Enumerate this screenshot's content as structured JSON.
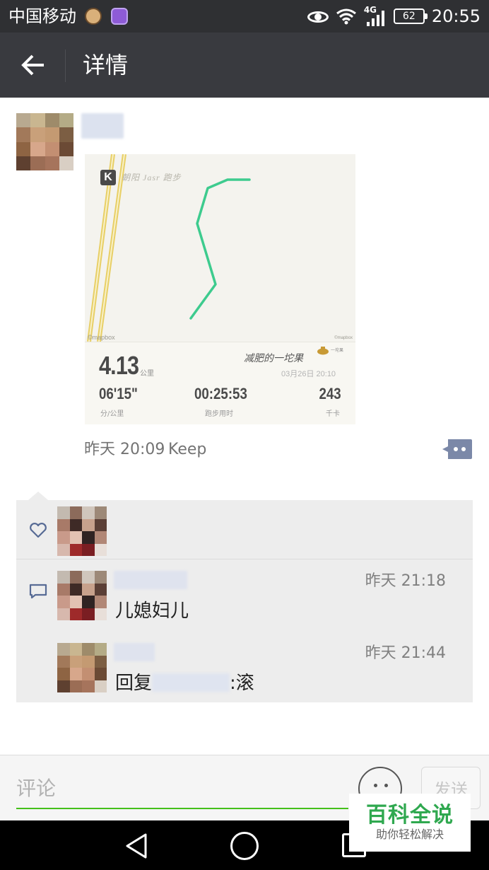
{
  "status_bar": {
    "carrier": "中国移动",
    "network": "4G",
    "battery": "62",
    "time": "20:55",
    "icons": [
      "eye-icon",
      "wifi-icon",
      "signal-icon",
      "battery-icon"
    ]
  },
  "header": {
    "title": "详情",
    "back_icon": "arrow-left-icon",
    "bg_color": "#393a3f"
  },
  "post": {
    "run_card": {
      "app_logo": "K",
      "map_caption": "朝阳 Jasr 跑步",
      "map_credit_left": "©mapbox",
      "map_credit_right": "©mapbox",
      "distance": "4.13",
      "distance_unit": "公里",
      "slogan": "减肥的一坨果",
      "pot_label": "一坨果",
      "datetime": "03月26日 20:10",
      "pace": "06'15\"",
      "pace_unit": "分/公里",
      "duration": "00:25:53",
      "duration_unit": "跑步用时",
      "calories": "243",
      "calories_unit": "千卡",
      "route_color": "#3dcb8e"
    },
    "time": "昨天 20:09",
    "source": "Keep",
    "more_icon": "comment-more-icon"
  },
  "likes": {
    "icon": "heart-icon"
  },
  "comments": [
    {
      "time": "昨天 21:18",
      "text": "儿媳妇儿"
    },
    {
      "time": "昨天 21:44",
      "text_prefix": "回复",
      "text_suffix": ":滚"
    }
  ],
  "input": {
    "placeholder": "评论",
    "send_label": "发送",
    "accent_color": "#45c01a"
  },
  "watermark": {
    "main": "百科全说",
    "sub": "助你轻松解决"
  }
}
